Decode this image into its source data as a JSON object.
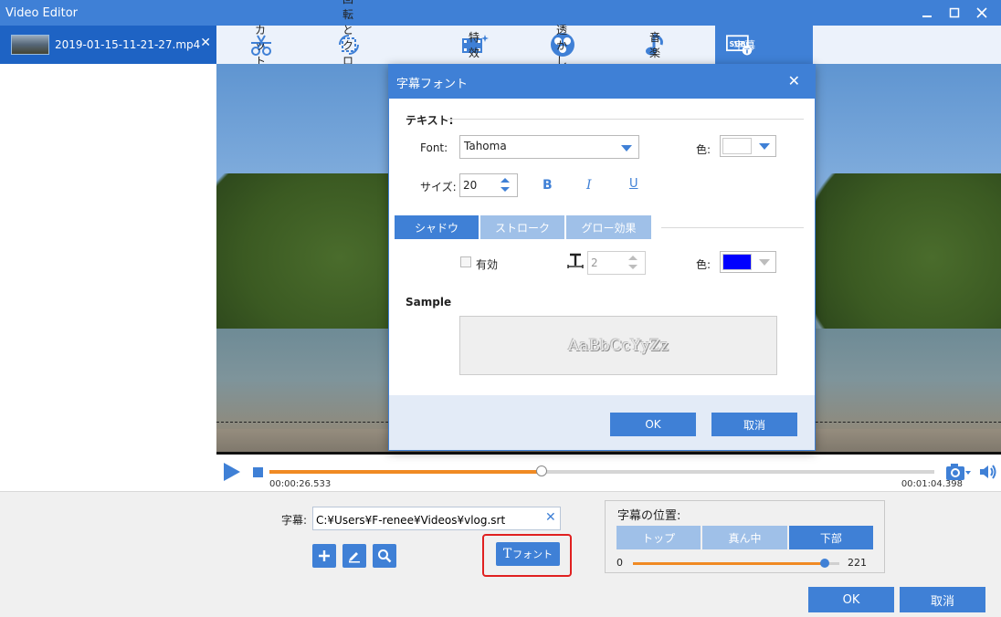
{
  "window": {
    "title": "Video Editor"
  },
  "file_tab": {
    "name": "2019-01-15-11-21-27.mp4"
  },
  "toolbar": {
    "tools": [
      {
        "label": "カット",
        "icon": "cut-icon"
      },
      {
        "label": "回転とクロップ",
        "icon": "crop-icon"
      },
      {
        "label": "特效",
        "icon": "effects-icon"
      },
      {
        "label": "透かし",
        "icon": "watermark-icon"
      },
      {
        "label": "音楽",
        "icon": "music-icon"
      },
      {
        "label": "字幕",
        "icon": "subtitle-icon",
        "active": true
      }
    ]
  },
  "playback": {
    "current_time": "00:00:26.533",
    "total_time": "00:01:04.398",
    "progress": 0.41
  },
  "subtitle": {
    "label": "字幕:",
    "path": "C:¥Users¥F-renee¥Videos¥vlog.srt",
    "font_button": "フォント",
    "font_button_glyph": "T"
  },
  "position": {
    "title": "字幕の位置:",
    "options": [
      "トップ",
      "真ん中",
      "下部"
    ],
    "selected": "下部",
    "min": "0",
    "max": "221",
    "value_fraction": 0.93
  },
  "buttons": {
    "ok": "OK",
    "cancel": "取消"
  },
  "dialog": {
    "title": "字幕フォント",
    "text_section": "テキスト:",
    "font_label": "Font:",
    "font_value": "Tahoma",
    "color_label": "色:",
    "size_label": "サイズ:",
    "size_value": "20",
    "bold": "B",
    "italic": "I",
    "underline": "U",
    "effect_tabs": [
      "シャドウ",
      "ストローク",
      "グロー効果"
    ],
    "selected_effect": "シャドウ",
    "enable_label": "有効",
    "effect_size_value": "2",
    "effect_color_label": "色:",
    "text_color": "#ffffff",
    "effect_color": "#0000ff",
    "sample_title": "Sample",
    "sample_text": "AaBbCcYyZz",
    "ok": "OK",
    "cancel": "取消"
  },
  "colors": {
    "accent": "#3f80d6",
    "progress": "#f08a24",
    "highlight": "#e02020"
  }
}
